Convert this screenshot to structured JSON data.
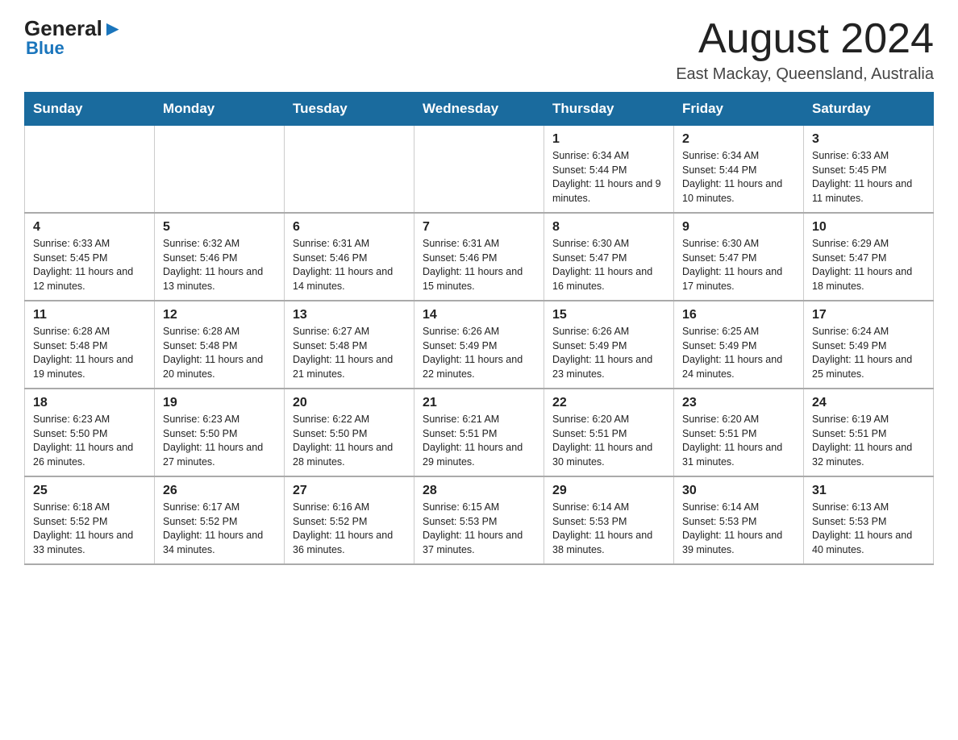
{
  "logo": {
    "text_general": "General",
    "text_blue": "Blue"
  },
  "header": {
    "title": "August 2024",
    "subtitle": "East Mackay, Queensland, Australia"
  },
  "days_of_week": [
    "Sunday",
    "Monday",
    "Tuesday",
    "Wednesday",
    "Thursday",
    "Friday",
    "Saturday"
  ],
  "weeks": [
    [
      {
        "day": "",
        "info": ""
      },
      {
        "day": "",
        "info": ""
      },
      {
        "day": "",
        "info": ""
      },
      {
        "day": "",
        "info": ""
      },
      {
        "day": "1",
        "info": "Sunrise: 6:34 AM\nSunset: 5:44 PM\nDaylight: 11 hours and 9 minutes."
      },
      {
        "day": "2",
        "info": "Sunrise: 6:34 AM\nSunset: 5:44 PM\nDaylight: 11 hours and 10 minutes."
      },
      {
        "day": "3",
        "info": "Sunrise: 6:33 AM\nSunset: 5:45 PM\nDaylight: 11 hours and 11 minutes."
      }
    ],
    [
      {
        "day": "4",
        "info": "Sunrise: 6:33 AM\nSunset: 5:45 PM\nDaylight: 11 hours and 12 minutes."
      },
      {
        "day": "5",
        "info": "Sunrise: 6:32 AM\nSunset: 5:46 PM\nDaylight: 11 hours and 13 minutes."
      },
      {
        "day": "6",
        "info": "Sunrise: 6:31 AM\nSunset: 5:46 PM\nDaylight: 11 hours and 14 minutes."
      },
      {
        "day": "7",
        "info": "Sunrise: 6:31 AM\nSunset: 5:46 PM\nDaylight: 11 hours and 15 minutes."
      },
      {
        "day": "8",
        "info": "Sunrise: 6:30 AM\nSunset: 5:47 PM\nDaylight: 11 hours and 16 minutes."
      },
      {
        "day": "9",
        "info": "Sunrise: 6:30 AM\nSunset: 5:47 PM\nDaylight: 11 hours and 17 minutes."
      },
      {
        "day": "10",
        "info": "Sunrise: 6:29 AM\nSunset: 5:47 PM\nDaylight: 11 hours and 18 minutes."
      }
    ],
    [
      {
        "day": "11",
        "info": "Sunrise: 6:28 AM\nSunset: 5:48 PM\nDaylight: 11 hours and 19 minutes."
      },
      {
        "day": "12",
        "info": "Sunrise: 6:28 AM\nSunset: 5:48 PM\nDaylight: 11 hours and 20 minutes."
      },
      {
        "day": "13",
        "info": "Sunrise: 6:27 AM\nSunset: 5:48 PM\nDaylight: 11 hours and 21 minutes."
      },
      {
        "day": "14",
        "info": "Sunrise: 6:26 AM\nSunset: 5:49 PM\nDaylight: 11 hours and 22 minutes."
      },
      {
        "day": "15",
        "info": "Sunrise: 6:26 AM\nSunset: 5:49 PM\nDaylight: 11 hours and 23 minutes."
      },
      {
        "day": "16",
        "info": "Sunrise: 6:25 AM\nSunset: 5:49 PM\nDaylight: 11 hours and 24 minutes."
      },
      {
        "day": "17",
        "info": "Sunrise: 6:24 AM\nSunset: 5:49 PM\nDaylight: 11 hours and 25 minutes."
      }
    ],
    [
      {
        "day": "18",
        "info": "Sunrise: 6:23 AM\nSunset: 5:50 PM\nDaylight: 11 hours and 26 minutes."
      },
      {
        "day": "19",
        "info": "Sunrise: 6:23 AM\nSunset: 5:50 PM\nDaylight: 11 hours and 27 minutes."
      },
      {
        "day": "20",
        "info": "Sunrise: 6:22 AM\nSunset: 5:50 PM\nDaylight: 11 hours and 28 minutes."
      },
      {
        "day": "21",
        "info": "Sunrise: 6:21 AM\nSunset: 5:51 PM\nDaylight: 11 hours and 29 minutes."
      },
      {
        "day": "22",
        "info": "Sunrise: 6:20 AM\nSunset: 5:51 PM\nDaylight: 11 hours and 30 minutes."
      },
      {
        "day": "23",
        "info": "Sunrise: 6:20 AM\nSunset: 5:51 PM\nDaylight: 11 hours and 31 minutes."
      },
      {
        "day": "24",
        "info": "Sunrise: 6:19 AM\nSunset: 5:51 PM\nDaylight: 11 hours and 32 minutes."
      }
    ],
    [
      {
        "day": "25",
        "info": "Sunrise: 6:18 AM\nSunset: 5:52 PM\nDaylight: 11 hours and 33 minutes."
      },
      {
        "day": "26",
        "info": "Sunrise: 6:17 AM\nSunset: 5:52 PM\nDaylight: 11 hours and 34 minutes."
      },
      {
        "day": "27",
        "info": "Sunrise: 6:16 AM\nSunset: 5:52 PM\nDaylight: 11 hours and 36 minutes."
      },
      {
        "day": "28",
        "info": "Sunrise: 6:15 AM\nSunset: 5:53 PM\nDaylight: 11 hours and 37 minutes."
      },
      {
        "day": "29",
        "info": "Sunrise: 6:14 AM\nSunset: 5:53 PM\nDaylight: 11 hours and 38 minutes."
      },
      {
        "day": "30",
        "info": "Sunrise: 6:14 AM\nSunset: 5:53 PM\nDaylight: 11 hours and 39 minutes."
      },
      {
        "day": "31",
        "info": "Sunrise: 6:13 AM\nSunset: 5:53 PM\nDaylight: 11 hours and 40 minutes."
      }
    ]
  ]
}
